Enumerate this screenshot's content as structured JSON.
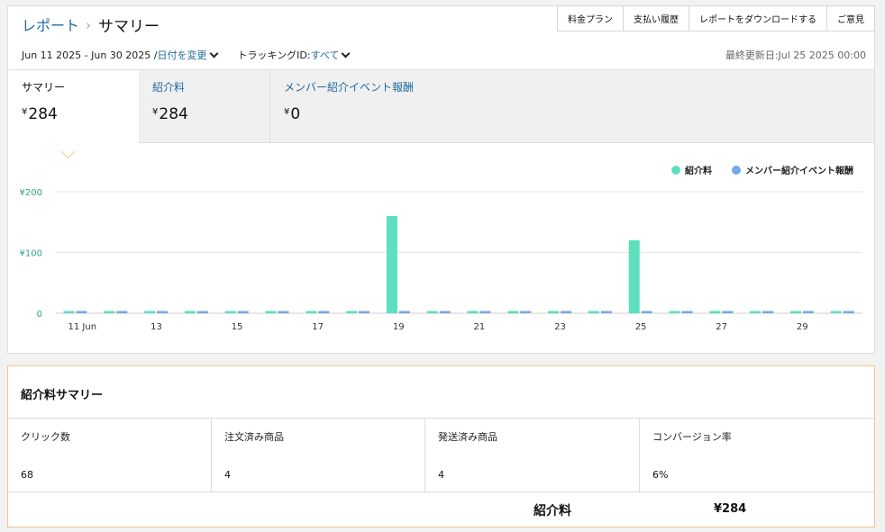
{
  "breadcrumb": {
    "parent": "レポート",
    "current": "サマリー"
  },
  "top_links": [
    "料金プラン",
    "支払い履歴",
    "レポートをダウンロードする",
    "ご意見"
  ],
  "filters": {
    "date_range": "Jun 11 2025 - Jun 30 2025 /",
    "date_change": "日付を変更",
    "tracking_label": "トラッキングID:",
    "tracking_value": "すべて"
  },
  "last_updated": "最終更新日:Jul 25 2025 00:00",
  "metrics": [
    {
      "label": "サマリー",
      "currency": "¥",
      "value": "284"
    },
    {
      "label": "紹介料",
      "currency": "¥",
      "value": "284"
    },
    {
      "label": "メンバー紹介イベント報酬",
      "currency": "¥",
      "value": "0"
    }
  ],
  "colors": {
    "referral": "#5ce0bd",
    "member": "#74a9e6",
    "accent": "#f3c58a",
    "link": "#1f6b9e"
  },
  "chart_data": {
    "type": "bar",
    "categories": [
      "11 Jun",
      "12",
      "13",
      "14",
      "15",
      "16",
      "17",
      "18",
      "19",
      "20",
      "21",
      "22",
      "23",
      "24",
      "25",
      "26",
      "27",
      "28",
      "29",
      "30"
    ],
    "tick_labels": [
      "11 Jun",
      "",
      "13",
      "",
      "15",
      "",
      "17",
      "",
      "19",
      "",
      "21",
      "",
      "23",
      "",
      "25",
      "",
      "27",
      "",
      "29",
      ""
    ],
    "series": [
      {
        "name": "紹介料",
        "color": "#5ce0bd",
        "values": [
          0,
          0,
          0,
          0,
          0,
          0,
          0,
          0,
          160,
          0,
          0,
          0,
          0,
          0,
          120,
          0,
          0,
          0,
          0,
          0
        ]
      },
      {
        "name": "メンバー紹介イベント報酬",
        "color": "#74a9e6",
        "values": [
          0,
          0,
          0,
          0,
          0,
          0,
          0,
          0,
          0,
          0,
          0,
          0,
          0,
          0,
          0,
          0,
          0,
          0,
          0,
          0
        ]
      }
    ],
    "y_ticks": [
      0,
      100,
      200
    ],
    "y_tick_labels": [
      "0",
      "¥100",
      "¥200"
    ],
    "ylim": [
      0,
      200
    ],
    "legend": "top-right",
    "grid": true
  },
  "referral_summary": {
    "title": "紹介料サマリー",
    "stats": [
      {
        "label": "クリック数",
        "value": "68"
      },
      {
        "label": "注文済み商品",
        "value": "4"
      },
      {
        "label": "発送済み商品",
        "value": "4"
      },
      {
        "label": "コンバージョン率",
        "value": "6%"
      }
    ],
    "total_label": "紹介料",
    "total_value": "¥284"
  }
}
